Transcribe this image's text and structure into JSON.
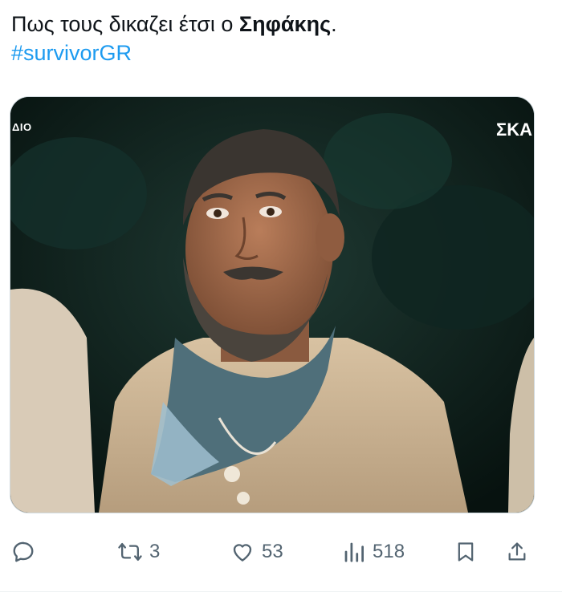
{
  "tweet": {
    "text_prefix": "Πως τους δικαζει έτσι ο ",
    "text_bold": "Σηφάκης",
    "text_suffix": ".",
    "hashtag": "#survivorGR"
  },
  "media": {
    "overlay_left": "ΔΙΟ",
    "overlay_right": "ΣΚΑ"
  },
  "actions": {
    "reply_icon": "reply-bubble-icon",
    "retweet_icon": "retweet-icon",
    "retweet_count": "3",
    "like_icon": "heart-icon",
    "like_count": "53",
    "views_icon": "bar-chart-icon",
    "views_count": "518",
    "bookmark_icon": "bookmark-icon",
    "share_icon": "share-upload-icon"
  },
  "colors": {
    "hashtag": "#1d9bf0",
    "action_icon": "#536471"
  }
}
